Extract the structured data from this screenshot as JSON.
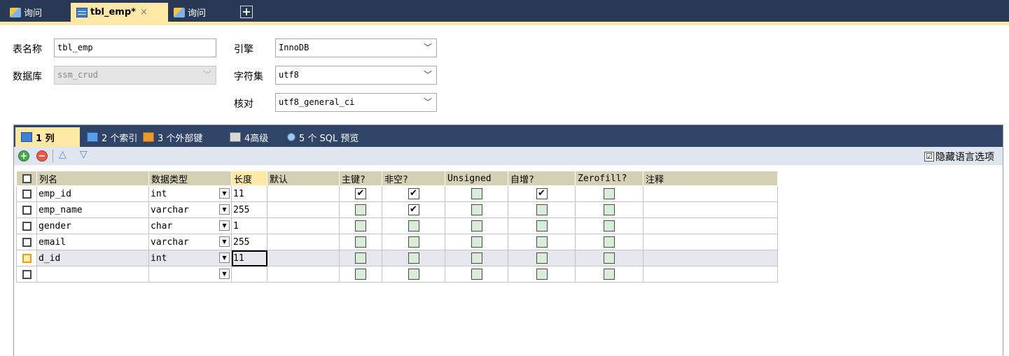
{
  "tabs": [
    {
      "label": "询问",
      "icon": "query-icon"
    },
    {
      "label": "tbl_emp*",
      "icon": "table-icon",
      "close": "×"
    },
    {
      "label": "询问",
      "icon": "query-icon"
    }
  ],
  "new_tab": "+",
  "form": {
    "table_name_label": "表名称",
    "table_name_value": "tbl_emp",
    "database_label": "数据库",
    "database_value": "ssm_crud",
    "engine_label": "引擎",
    "engine_value": "InnoDB",
    "charset_label": "字符集",
    "charset_value": "utf8",
    "collation_label": "核对",
    "collation_value": "utf8_general_ci"
  },
  "subtabs": [
    {
      "label": "1 列"
    },
    {
      "label": "2 个索引"
    },
    {
      "label": "3 个外部键"
    },
    {
      "label": "4高级"
    },
    {
      "label": "5 个 SQL 预览"
    }
  ],
  "toolbar": {
    "hide_lang_label": "隐藏语言选项",
    "hide_lang_checked": "☑"
  },
  "grid": {
    "headers": {
      "name": "列名",
      "type": "数据类型",
      "length": "长度",
      "default": "默认",
      "pk": "主键?",
      "notnull": "非空?",
      "unsigned": "Unsigned",
      "autoinc": "自增?",
      "zerofill": "Zerofill?",
      "comment": "注释"
    },
    "rows": [
      {
        "name": "emp_id",
        "type": "int",
        "length": "11",
        "default": "",
        "pk": true,
        "notnull": true,
        "unsigned": false,
        "autoinc": true,
        "zerofill": false,
        "comment": ""
      },
      {
        "name": "emp_name",
        "type": "varchar",
        "length": "255",
        "default": "",
        "pk": false,
        "notnull": true,
        "unsigned": false,
        "autoinc": false,
        "zerofill": false,
        "comment": ""
      },
      {
        "name": "gender",
        "type": "char",
        "length": "1",
        "default": "",
        "pk": false,
        "notnull": false,
        "unsigned": false,
        "autoinc": false,
        "zerofill": false,
        "comment": ""
      },
      {
        "name": "email",
        "type": "varchar",
        "length": "255",
        "default": "",
        "pk": false,
        "notnull": false,
        "unsigned": false,
        "autoinc": false,
        "zerofill": false,
        "comment": ""
      },
      {
        "name": "d_id",
        "type": "int",
        "length": "11",
        "default": "",
        "pk": false,
        "notnull": false,
        "unsigned": false,
        "autoinc": false,
        "zerofill": false,
        "comment": ""
      },
      {
        "name": "",
        "type": "",
        "length": "",
        "default": "",
        "pk": false,
        "notnull": false,
        "unsigned": false,
        "autoinc": false,
        "zerofill": false,
        "comment": ""
      }
    ]
  }
}
